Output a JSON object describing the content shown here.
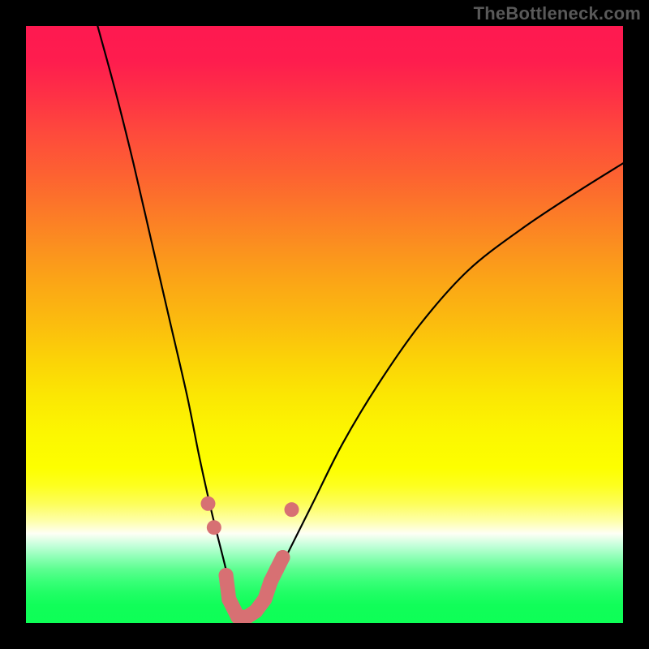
{
  "watermark": "TheBottleneck.com",
  "chart_data": {
    "type": "line",
    "title": "",
    "xlabel": "",
    "ylabel": "",
    "x_range": [
      0,
      100
    ],
    "y_range": [
      0,
      100
    ],
    "background_gradient": {
      "top": "#fe1950",
      "mid": "#fdff00",
      "bottom": "#0dff56"
    },
    "series": [
      {
        "name": "bottleneck-curve",
        "description": "V-shaped curve dipping to zero near x≈36 then rising gradually toward x=100 at y≈75",
        "x": [
          12,
          15,
          18,
          21,
          24,
          27,
          29,
          31,
          33,
          34.5,
          36,
          37.5,
          39,
          41,
          44,
          48,
          53,
          59,
          66,
          74,
          83,
          92,
          100
        ],
        "values": [
          100,
          89,
          77,
          64,
          51,
          38,
          28,
          19,
          11,
          5,
          1,
          1,
          3,
          6,
          12,
          20,
          30,
          40,
          50,
          59,
          66,
          72,
          77
        ]
      }
    ],
    "markers": {
      "name": "highlight-dots",
      "color": "#d77073",
      "points": [
        {
          "x": 30.5,
          "y": 20
        },
        {
          "x": 31.5,
          "y": 16
        },
        {
          "x": 33.5,
          "y": 8
        },
        {
          "x": 34,
          "y": 4
        },
        {
          "x": 35.5,
          "y": 1
        },
        {
          "x": 37,
          "y": 1
        },
        {
          "x": 38.5,
          "y": 2
        },
        {
          "x": 40,
          "y": 4
        },
        {
          "x": 41,
          "y": 7
        },
        {
          "x": 42,
          "y": 9
        },
        {
          "x": 43,
          "y": 11
        },
        {
          "x": 44.5,
          "y": 19
        }
      ]
    }
  }
}
